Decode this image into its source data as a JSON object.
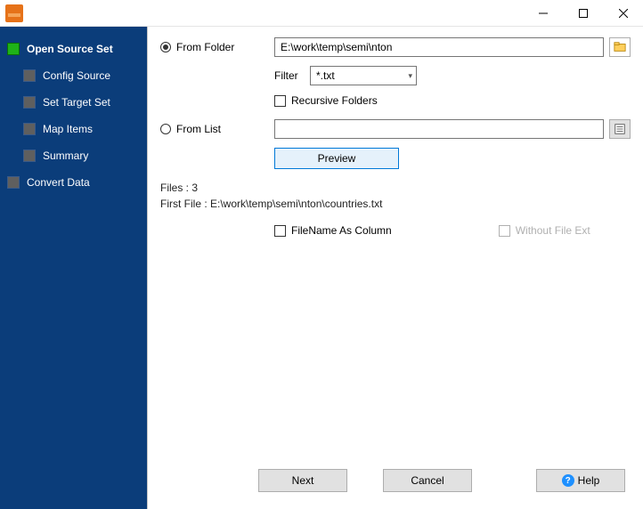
{
  "sidebar": {
    "items": [
      {
        "label": "Open Source Set",
        "active": true
      },
      {
        "label": "Config Source"
      },
      {
        "label": "Set Target Set"
      },
      {
        "label": "Map Items"
      },
      {
        "label": "Summary"
      },
      {
        "label": "Convert Data"
      }
    ]
  },
  "source": {
    "from_folder_label": "From Folder",
    "from_list_label": "From List",
    "folder_path": "E:\\work\\temp\\semi\\nton",
    "filter_label": "Filter",
    "filter_value": "*.txt",
    "recursive_label": "Recursive Folders",
    "preview_label": "Preview",
    "files_count": "Files : 3",
    "first_file": "First File : E:\\work\\temp\\semi\\nton\\countries.txt",
    "filename_col_label": "FileName As Column",
    "without_ext_label": "Without File Ext"
  },
  "footer": {
    "next": "Next",
    "cancel": "Cancel",
    "help": "Help"
  }
}
